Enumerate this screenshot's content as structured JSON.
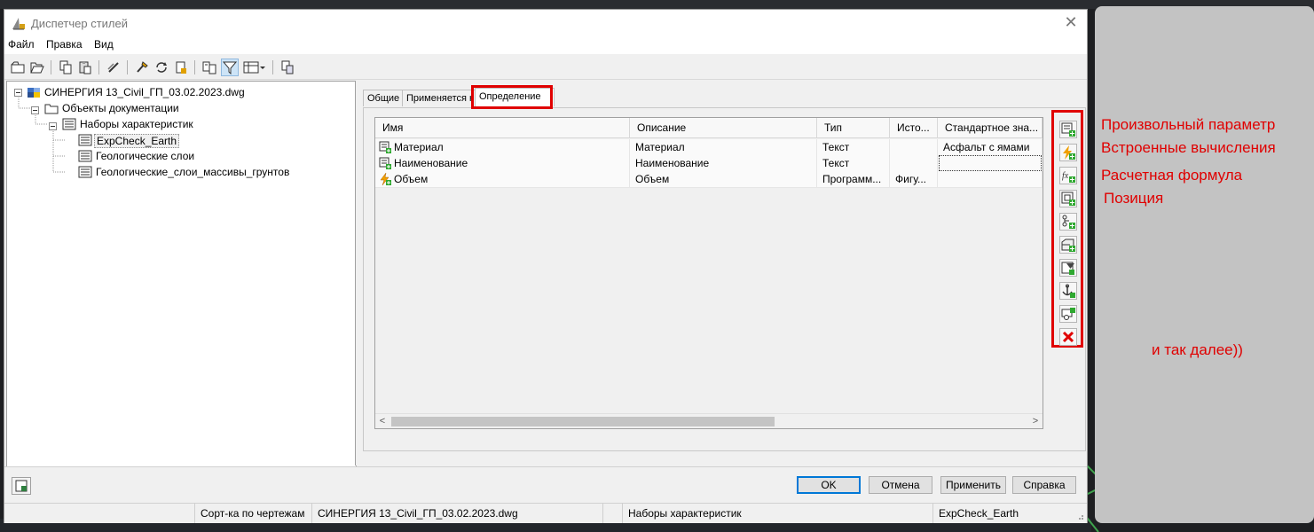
{
  "window": {
    "title": "Диспетчер стилей",
    "close_glyph": "✕"
  },
  "menu": [
    "Файл",
    "Правка",
    "Вид"
  ],
  "toolbar_icons": [
    "new-style-icon",
    "open-icon",
    "copy-icon",
    "paste-icon",
    "edit-icon",
    "purge-icon",
    "refresh-icon",
    "import-icon",
    "compare-icon",
    "filter-icon",
    "view-options-icon",
    "toggle-view-icon"
  ],
  "tree": {
    "root": "СИНЕРГИЯ 13_Civil_ГП_03.02.2023.dwg",
    "documentation": "Объекты документации",
    "property_sets": "Наборы характеристик",
    "items": [
      "ExpCheck_Earth",
      "Геологические слои",
      "Геологические_слои_массивы_грунтов"
    ]
  },
  "tabs": [
    "Общие",
    "Применяется к",
    "Определение"
  ],
  "grid": {
    "columns": [
      "Имя",
      "Описание",
      "Тип",
      "Исто...",
      "Стандартное зна..."
    ],
    "rows": [
      {
        "name": "Материал",
        "desc": "Материал",
        "type": "Текст",
        "src": "",
        "default": "Асфальт с ямами",
        "icon": "manual-property-icon"
      },
      {
        "name": "Наименование",
        "desc": "Наименование",
        "type": "Текст",
        "src": "",
        "default": "",
        "icon": "manual-property-icon"
      },
      {
        "name": "Объем",
        "desc": "Объем",
        "type": "Программ...",
        "src": "Фигу...",
        "default": "",
        "icon": "automatic-property-icon"
      }
    ],
    "scroll_left": "<",
    "scroll_right": ">"
  },
  "sidebar_buttons": [
    "add-manual-property-icon",
    "add-automatic-property-icon",
    "add-formula-property-icon",
    "add-location-property-icon",
    "add-classification-property-icon",
    "add-material-property-icon",
    "add-graphic-property-icon",
    "add-anchor-property-icon",
    "add-project-property-icon",
    "delete-property-icon"
  ],
  "buttons": {
    "ok": "OK",
    "cancel": "Отмена",
    "apply": "Применить",
    "help": "Справка"
  },
  "status": {
    "sort": "Сорт-ка по чертежам",
    "drawing": "СИНЕРГИЯ 13_Civil_ГП_03.02.2023.dwg",
    "category": "Наборы характеристик",
    "style": "ExpCheck_Earth"
  },
  "annotations": {
    "manual": "Произвольный параметр",
    "auto": "Встроенные вычисления",
    "formula": "Расчетная формула",
    "location": "Позиция",
    "etc": "и так далее))"
  },
  "colors": {
    "highlight": "#e00000",
    "panel": "#c3c3c3",
    "accent": "#0078d7"
  }
}
